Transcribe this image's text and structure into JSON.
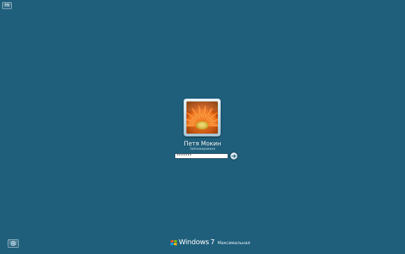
{
  "keyboard": {
    "language": "EN"
  },
  "user": {
    "name": "Петя Мокин",
    "status": "Заблокировано"
  },
  "password": {
    "masked_value": "•••••••"
  },
  "branding": {
    "product": "Windows",
    "version": "7",
    "edition": "Максимальная"
  },
  "icons": {
    "submit": "arrow-right-icon",
    "ease_of_access": "ease-of-access-icon",
    "windows_logo": "windows-logo-icon",
    "avatar": "flower-avatar"
  },
  "colors": {
    "background": "#1f5f7b",
    "tile_frame": "#d7e6ef",
    "accent_orange": "#e07a1a"
  }
}
